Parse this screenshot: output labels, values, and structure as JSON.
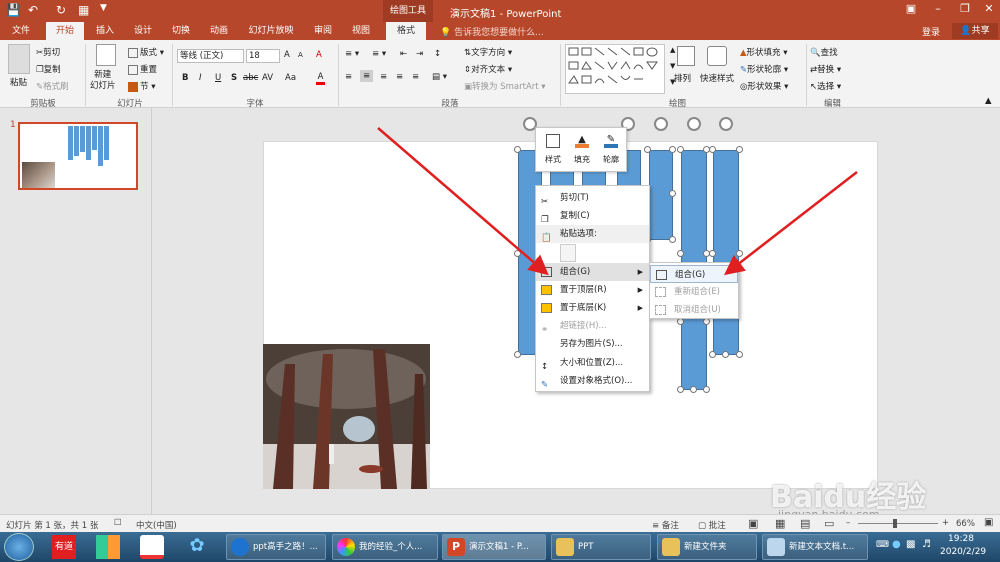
{
  "title_bar": {
    "tool_tab": "绘图工具",
    "title": "演示文稿1 - PowerPoint",
    "login": "登录",
    "share": "共享"
  },
  "tabs": [
    "文件",
    "开始",
    "插入",
    "设计",
    "切换",
    "动画",
    "幻灯片放映",
    "审阅",
    "视图",
    "格式"
  ],
  "active_tab": "开始",
  "tell_me": "告诉我您想要做什么...",
  "ribbon": {
    "clipboard": {
      "paste": "粘贴",
      "cut": "剪切",
      "copy": "复制",
      "format_painter": "格式刷",
      "label": "剪贴板"
    },
    "slides": {
      "new_slide": "新建\n幻灯片",
      "layout": "版式",
      "reset": "重置",
      "section": "节",
      "label": "幻灯片"
    },
    "font": {
      "font_name": "等线 (正文)",
      "font_size": "18",
      "bold": "B",
      "italic": "I",
      "underline": "U",
      "shadow": "S",
      "strike": "abc",
      "spacing": "AV",
      "case": "Aa",
      "color": "A",
      "grow": "A",
      "shrink": "A",
      "clear": "A",
      "label": "字体"
    },
    "paragraph": {
      "text_direction": "文字方向",
      "align_text": "对齐文本",
      "smartart": "转换为 SmartArt",
      "label": "段落"
    },
    "drawing": {
      "arrange": "排列",
      "quick_styles": "快速样式",
      "shape_fill": "形状填充",
      "shape_outline": "形状轮廓",
      "shape_effects": "形状效果",
      "label": "绘图"
    },
    "editing": {
      "find": "查找",
      "replace": "替换",
      "select": "选择",
      "label": "编辑"
    }
  },
  "slide_thumb_number": "1",
  "mini_toolbar": {
    "style": "样式",
    "fill": "填充",
    "outline": "轮廓"
  },
  "context_menu": [
    {
      "label": "剪切(T)",
      "icon": "scissors-icon",
      "disabled": false,
      "submenu": false
    },
    {
      "label": "复制(C)",
      "icon": "copy-icon",
      "disabled": false,
      "submenu": false
    },
    {
      "label": "粘贴选项:",
      "icon": "paste-icon",
      "disabled": false,
      "submenu": false,
      "header": true
    },
    {
      "label": "组合(G)",
      "icon": "group-icon",
      "disabled": false,
      "submenu": true,
      "highlight": true
    },
    {
      "label": "置于顶层(R)",
      "icon": "bring-front-icon",
      "disabled": false,
      "submenu": true
    },
    {
      "label": "置于底层(K)",
      "icon": "send-back-icon",
      "disabled": false,
      "submenu": true
    },
    {
      "label": "超链接(H)...",
      "icon": "hyperlink-icon",
      "disabled": true,
      "submenu": false
    },
    {
      "label": "另存为图片(S)...",
      "icon": "",
      "disabled": false,
      "submenu": false
    },
    {
      "label": "大小和位置(Z)...",
      "icon": "size-icon",
      "disabled": false,
      "submenu": false
    },
    {
      "label": "设置对象格式(O)...",
      "icon": "format-icon",
      "disabled": false,
      "submenu": false
    }
  ],
  "submenu": [
    {
      "label": "组合(G)",
      "disabled": false
    },
    {
      "label": "重新组合(E)",
      "disabled": true
    },
    {
      "label": "取消组合(U)",
      "disabled": true
    }
  ],
  "status_bar": {
    "slide_info": "幻灯片 第 1 张，共 1 张",
    "language": "中文(中国)",
    "notes": "备注",
    "comments": "批注",
    "zoom": "66%"
  },
  "taskbar": {
    "apps": [
      {
        "label": "ppt高手之路！..."
      },
      {
        "label": "我的经验_个人..."
      },
      {
        "label": "演示文稿1 - P..."
      },
      {
        "label": "PPT"
      },
      {
        "label": "新建文件夹"
      },
      {
        "label": "新建文本文档.t..."
      }
    ],
    "time": "19:28",
    "date": "2020/2/29"
  },
  "watermark": "Baidu经验",
  "watermark_url": "jingyan.baidu.com",
  "colors": {
    "accent": "#b7472a",
    "shape_blue": "#5b9bd5",
    "arrow_red": "#e02020"
  }
}
